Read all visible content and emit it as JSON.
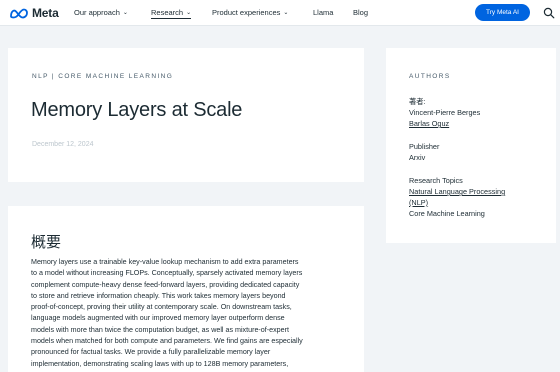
{
  "nav": {
    "logo_text": "Meta",
    "items": [
      {
        "label": "Our approach",
        "has_dropdown": true
      },
      {
        "label": "Research",
        "has_dropdown": true,
        "active": true
      },
      {
        "label": "Product experiences",
        "has_dropdown": true
      },
      {
        "label": "Llama"
      },
      {
        "label": "Blog"
      }
    ],
    "cta_label": "Try Meta AI",
    "search_icon": "search-icon",
    "chevron_icon": "chevron-down-icon",
    "accent_color": "#0064e0"
  },
  "header": {
    "eyebrow": "NLP | CORE MACHINE LEARNING",
    "title": "Memory Layers at Scale",
    "date": "December 12, 2024"
  },
  "abstract": {
    "heading": "概要",
    "lines": [
      "Memory layers use a trainable key-value lookup mechanism to add extra parameters",
      "to a model without increasing FLOPs. Conceptually, sparsely activated memory layers",
      "complement compute-heavy dense feed-forward layers, providing dedicated capacity",
      "to store and retrieve information cheaply. This work takes memory layers beyond",
      "proof-of-concept, proving their utility at contemporary scale. On downstream tasks,",
      "language models augmented with our improved memory layer outperform dense",
      "models with more than twice the computation budget, as well as mixture-of-expert",
      "models when matched for both compute and parameters. We find gains are especially",
      "pronounced for factual tasks. We provide a fully parallelizable memory layer",
      "implementation, demonstrating scaling laws with up to 128B memory parameters,"
    ]
  },
  "sidebar": {
    "label": "AUTHORS",
    "authors_prefix": "著者:",
    "authors": [
      {
        "name": "Vincent-Pierre Berges",
        "link": false
      },
      {
        "name": "Barlas Oguz",
        "link": true
      }
    ],
    "publisher_label": "Publisher",
    "publisher": "Arxiv",
    "topics_label": "Research Topics",
    "topics": [
      {
        "text": "Natural Language Processing",
        "link": true
      },
      {
        "text": "(NLP)",
        "link": true
      },
      {
        "text": "Core Machine Learning",
        "link": false
      }
    ]
  }
}
